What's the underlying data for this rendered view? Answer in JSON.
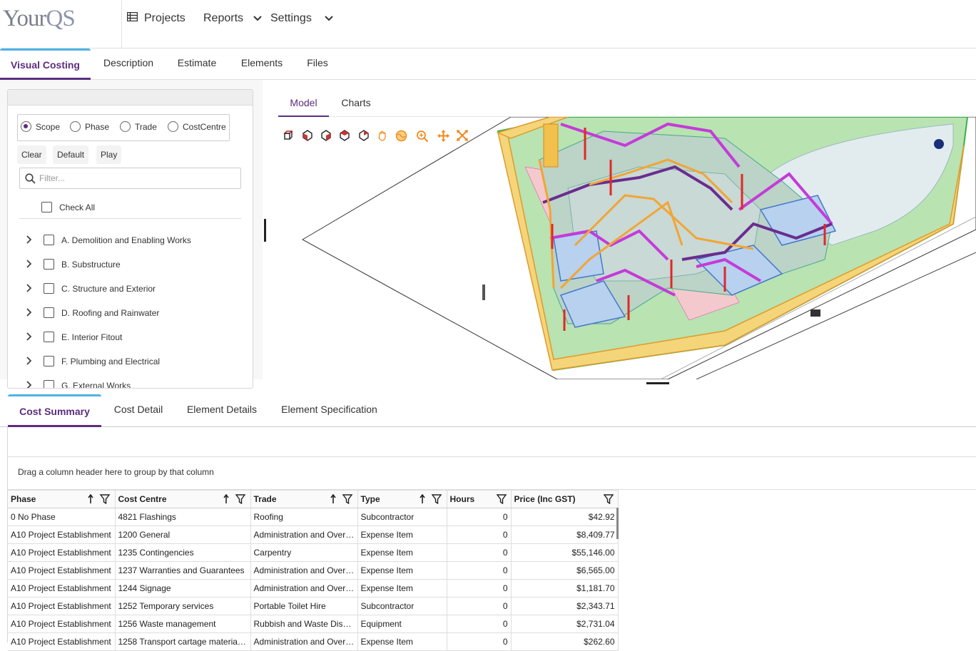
{
  "app": {
    "logo_main": "Your",
    "logo_accent": "QS"
  },
  "nav": {
    "projects": "Projects",
    "reports": "Reports",
    "settings": "Settings"
  },
  "top_tabs": [
    "Visual Costing",
    "Description",
    "Estimate",
    "Elements",
    "Files"
  ],
  "filter": {
    "radios": [
      "Scope",
      "Phase",
      "Trade",
      "CostCentre"
    ],
    "selected_radio": "Scope",
    "buttons": {
      "clear": "Clear",
      "default": "Default",
      "play": "Play"
    },
    "search_placeholder": "Filter...",
    "check_all": "Check All",
    "tree": [
      "A. Demolition and Enabling Works",
      "B. Substructure",
      "C. Structure and Exterior",
      "D. Roofing and Rainwater",
      "E. Interior Fitout",
      "F. Plumbing and Electrical",
      "G. External Works"
    ]
  },
  "model": {
    "tabs": [
      "Model",
      "Charts"
    ]
  },
  "bottom_tabs": [
    "Cost Summary",
    "Cost Detail",
    "Element Details",
    "Element Specification"
  ],
  "grid": {
    "group_hint": "Drag a column header here to group by that column",
    "columns": [
      "Phase",
      "Cost Centre",
      "Trade",
      "Type",
      "Hours",
      "Price (Inc GST)"
    ],
    "rows": [
      [
        "0 No Phase",
        "4821 Flashings",
        "Roofing",
        "Subcontractor",
        "0",
        "$42.92"
      ],
      [
        "A10 Project Establishment",
        "1200 General",
        "Administration and Over…",
        "Expense Item",
        "0",
        "$8,409.77"
      ],
      [
        "A10 Project Establishment",
        "1235 Contingencies",
        "Carpentry",
        "Expense Item",
        "0",
        "$55,146.00"
      ],
      [
        "A10 Project Establishment",
        "1237 Warranties and Guarantees",
        "Administration and Over…",
        "Expense Item",
        "0",
        "$6,565.00"
      ],
      [
        "A10 Project Establishment",
        "1244 Signage",
        "Administration and Over…",
        "Expense Item",
        "0",
        "$1,181.70"
      ],
      [
        "A10 Project Establishment",
        "1252 Temporary services",
        "Portable Toilet Hire",
        "Subcontractor",
        "0",
        "$2,343.71"
      ],
      [
        "A10 Project Establishment",
        "1256 Waste management",
        "Rubbish and Waste Dis…",
        "Equipment",
        "0",
        "$2,731.04"
      ],
      [
        "A10 Project Establishment",
        "1258 Transport cartage materia…",
        "Administration and Over…",
        "Expense Item",
        "0",
        "$262.60"
      ]
    ]
  },
  "colors": {
    "accent": "#5c2d7f",
    "tab_top": "#4fb3e6",
    "tool_orange": "#f08a1c"
  }
}
